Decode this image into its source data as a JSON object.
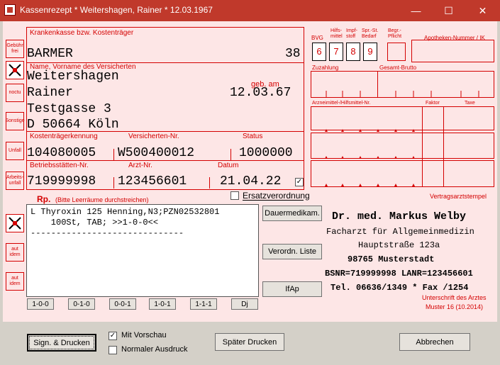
{
  "window": {
    "title": "Kassenrezept * Weitershagen, Rainer * 12.03.1967",
    "minimize": "—",
    "maximize": "☐",
    "close": "✕"
  },
  "side_icons": [
    "Gebühr frei",
    "",
    "noctu",
    "Sonstige",
    "Unfall",
    "Arbeits-unfall"
  ],
  "insurance": {
    "label_kasse": "Krankenkasse bzw. Kostenträger",
    "kasse": "BARMER",
    "kasse_code": "38",
    "label_name": "Name, Vorname des Versicherten",
    "surname": "Weitershagen",
    "firstname": "Rainer",
    "label_geb": "geb. am",
    "birthdate": "12.03.67",
    "street": "Testgasse 3",
    "city": "D 50664 Köln",
    "label_kt": "Kostenträgerkennung",
    "label_vnr": "Versicherten-Nr.",
    "label_status": "Status",
    "kt": "104080005",
    "vnr": "W500400012",
    "status": "1000000",
    "label_bsnr": "Betriebsstätten-Nr.",
    "label_arzt": "Arzt-Nr.",
    "label_datum": "Datum",
    "bsnr": "719999998",
    "arzt": "123456601",
    "datum": "21.04.22"
  },
  "right_header": {
    "bvg": "BVG",
    "hilfs": "Hilfs-mittel",
    "impf": "Impf-stoff",
    "spr": "Spr.-St. Bedarf",
    "begr": "Begr.-Pflicht",
    "apotheke": "Apotheken-Nummer / IK",
    "digits": [
      "6",
      "7",
      "8",
      "9"
    ],
    "zuzahlung": "Zuzahlung",
    "gesamt": "Gesamt-Brutto",
    "arznei": "Arzneimittel-/Hilfsmittel-Nr.",
    "faktor": "Faktor",
    "taxe": "Taxe"
  },
  "ersatz": "Ersatzverordnung",
  "vertragsarzt": "Vertragsarztstempel",
  "rp": {
    "label": "Rp.",
    "hint": "(Bitte Leerräume durchstreichen)",
    "line1": "L Thyroxin 125 Henning,N3;PZN02532801",
    "line2": "    100St, TAB; >>1-0-0<<",
    "line3": "------------------------------"
  },
  "aut_idem": "aut idem",
  "dose_buttons": [
    "1-0-0",
    "0-1-0",
    "0-0-1",
    "1-0-1",
    "1-1-1",
    "Dj"
  ],
  "side_buttons": [
    "Dauermedikam.",
    "Verordn. Liste",
    "IfAp"
  ],
  "doctor": {
    "name": "Dr. med. Markus Welby",
    "title": "Facharzt für Allgemeinmedizin",
    "street": "Hauptstraße 123a",
    "city": "98765 Musterstadt",
    "ids": "BSNR=719999998 LANR=123456601",
    "tel": "Tel. 06636/1349 * Fax /1254",
    "signature": "Unterschrift des Arztes",
    "muster": "Muster 16 (10.2014)"
  },
  "footer": {
    "sign": "Sign. & Drucken",
    "mit_vorschau": "Mit Vorschau",
    "normaler": "Normaler Ausdruck",
    "spaeter": "Später Drucken",
    "abbrechen": "Abbrechen"
  },
  "colors": {
    "accent": "#d40000",
    "titlebar": "#c0392b",
    "form_bg": "#fde6e6"
  }
}
